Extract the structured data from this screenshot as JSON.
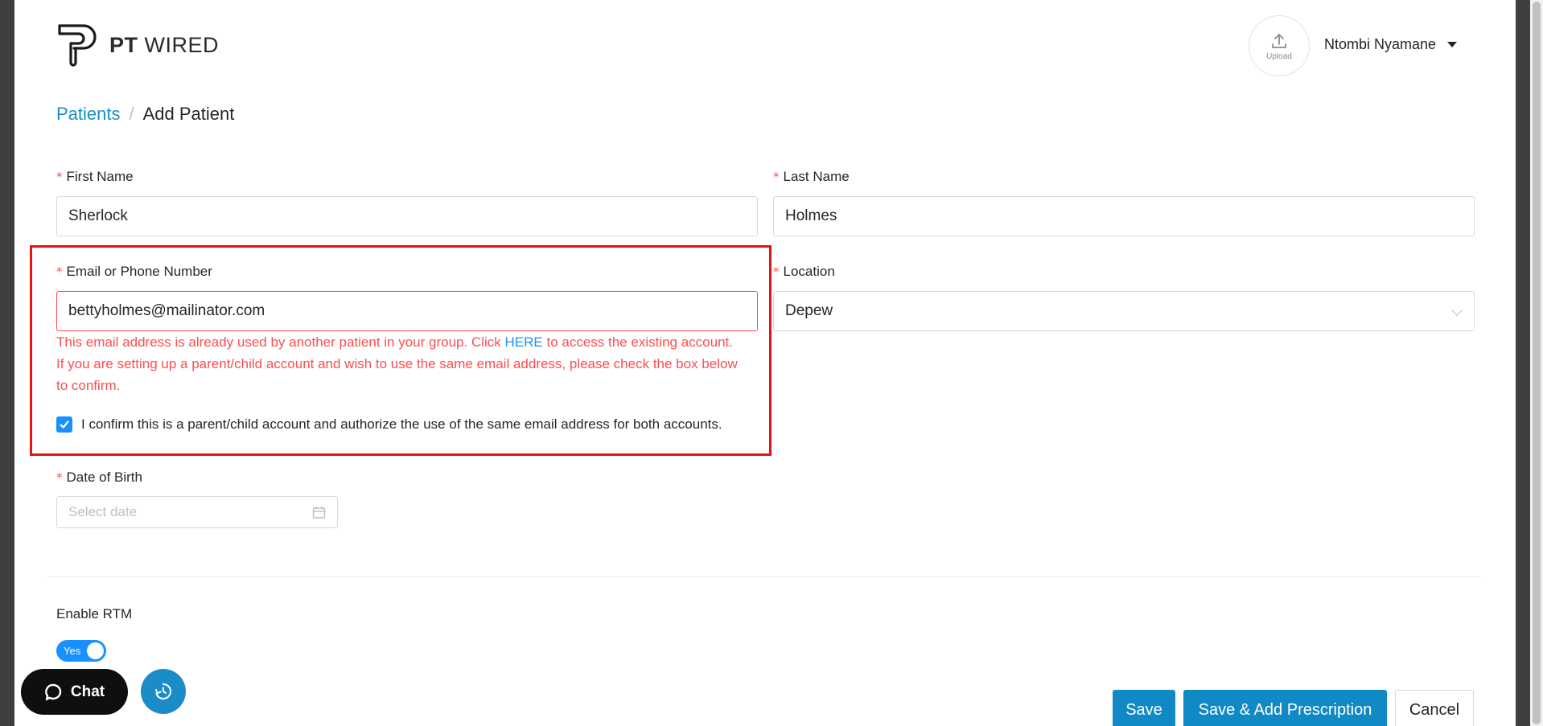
{
  "header": {
    "logo_bold": "PT",
    "logo_regular": "WIRED",
    "upload_label": "Upload",
    "user_name": "Ntombi Nyamane"
  },
  "breadcrumb": {
    "parent": "Patients",
    "separator": "/",
    "current": "Add Patient"
  },
  "form": {
    "required_mark": "*",
    "first_name": {
      "label": "First Name",
      "value": "Sherlock"
    },
    "last_name": {
      "label": "Last Name",
      "value": "Holmes"
    },
    "email": {
      "label": "Email or Phone Number",
      "value": "bettyholmes@mailinator.com",
      "error_part1": "This email address is already used by another patient in your group. Click ",
      "error_link": "HERE",
      "error_part2": " to access the existing account.",
      "error_line2": "If you are setting up a parent/child account and wish to use the same email address, please check the box below",
      "error_line3": "to confirm."
    },
    "confirm_checkbox": {
      "label": "I confirm this is a parent/child account and authorize the use of the same email address for both accounts.",
      "checked": true
    },
    "location": {
      "label": "Location",
      "value": "Depew"
    },
    "dob": {
      "label": "Date of Birth",
      "placeholder": "Select date"
    },
    "rtm": {
      "label": "Enable RTM",
      "toggle_text": "Yes",
      "enabled": true
    }
  },
  "actions": {
    "save": "Save",
    "save_add": "Save & Add Prescription",
    "cancel": "Cancel"
  },
  "widgets": {
    "chat_label": "Chat"
  },
  "colors": {
    "accent": "#1890ff",
    "primary_button": "#1189c4",
    "error": "#ff4d4f",
    "highlight_border": "#e01515"
  }
}
